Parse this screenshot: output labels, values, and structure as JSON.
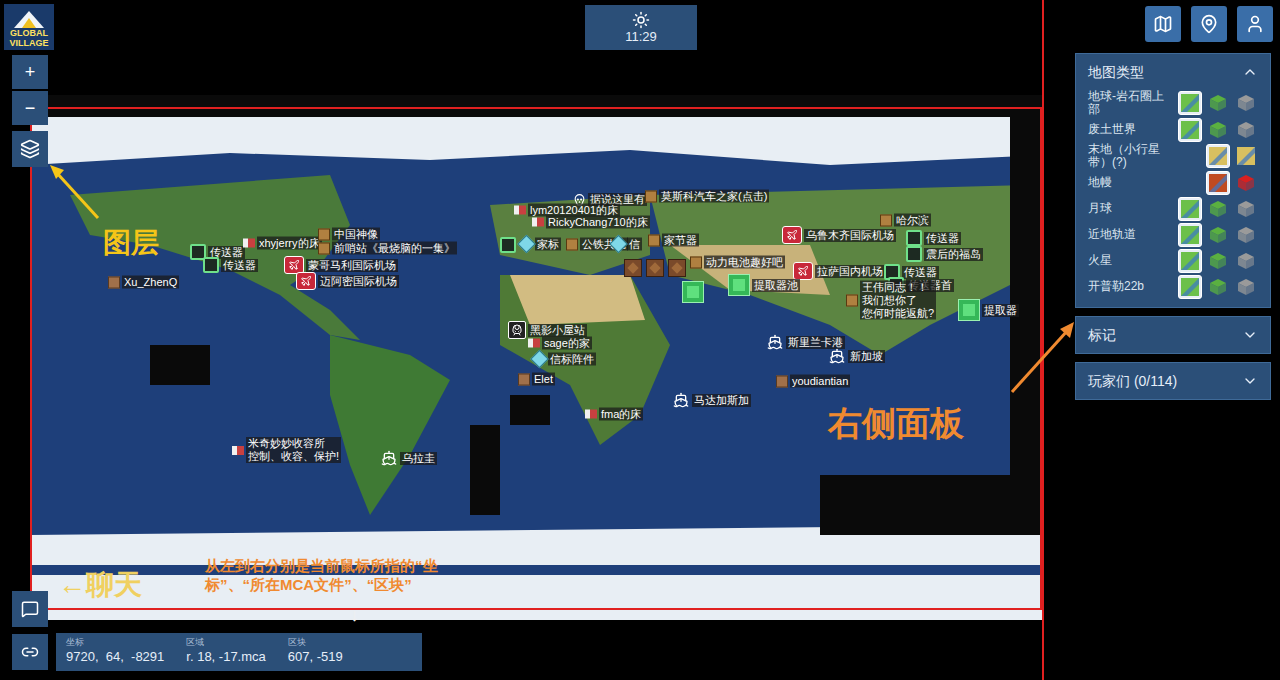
{
  "logo": {
    "lines": [
      "GLOBAL",
      "VILLAGE"
    ]
  },
  "clock": {
    "time": "11:29"
  },
  "zoom": {
    "in": "+",
    "out": "−"
  },
  "annotations": {
    "layers": "图层",
    "chat": "←聊天",
    "coords_hint": [
      "从左到右分别是当前鼠标所指的“坐",
      "标”、“所在MCA文件”、“区块”"
    ],
    "coords_arrow": "↓",
    "right_panel": "右侧面板"
  },
  "coords_bar": [
    {
      "label": "坐标",
      "value": "9720,  64,  -8291"
    },
    {
      "label": "区域",
      "value": "r. 18, -17.mca"
    },
    {
      "label": "区块",
      "value": "607, -519"
    }
  ],
  "panel": {
    "sections": [
      {
        "title": "地图类型",
        "expanded": true
      },
      {
        "title": "标记",
        "expanded": false
      },
      {
        "title": "玩家们 (0/114)",
        "expanded": false
      }
    ],
    "map_types": [
      {
        "label": "地球-岩石圈上部",
        "modes": [
          {
            "kind": "flat",
            "color": "#6cc04a",
            "selected": true
          },
          {
            "kind": "cube",
            "color": "#5ab040",
            "selected": false
          },
          {
            "kind": "cube",
            "color": "#9a9a9a",
            "selected": false
          }
        ]
      },
      {
        "label": "废土世界",
        "modes": [
          {
            "kind": "flat",
            "color": "#6cc04a",
            "selected": true
          },
          {
            "kind": "cube",
            "color": "#5ab040",
            "selected": false
          },
          {
            "kind": "cube",
            "color": "#9a9a9a",
            "selected": false
          }
        ]
      },
      {
        "label": "末地（小行星带）(?)",
        "modes": [
          {
            "kind": "flat",
            "color": "#d8c060",
            "selected": true
          },
          {
            "kind": "flat",
            "color": "#d8c060",
            "selected": false
          }
        ]
      },
      {
        "label": "地幔",
        "modes": [
          {
            "kind": "flat",
            "color": "#c04a20",
            "selected": true
          },
          {
            "kind": "cube",
            "color": "#d82020",
            "selected": false
          }
        ]
      },
      {
        "label": "月球",
        "modes": [
          {
            "kind": "flat",
            "color": "#6cc04a",
            "selected": true
          },
          {
            "kind": "cube",
            "color": "#5ab040",
            "selected": false
          },
          {
            "kind": "cube",
            "color": "#9a9a9a",
            "selected": false
          }
        ]
      },
      {
        "label": "近地轨道",
        "modes": [
          {
            "kind": "flat",
            "color": "#6cc04a",
            "selected": true
          },
          {
            "kind": "cube",
            "color": "#5ab040",
            "selected": false
          },
          {
            "kind": "cube",
            "color": "#9a9a9a",
            "selected": false
          }
        ]
      },
      {
        "label": "火星",
        "modes": [
          {
            "kind": "flat",
            "color": "#6cc04a",
            "selected": true
          },
          {
            "kind": "cube",
            "color": "#5ab040",
            "selected": false
          },
          {
            "kind": "cube",
            "color": "#9a9a9a",
            "selected": false
          }
        ]
      },
      {
        "label": "开普勒22b",
        "modes": [
          {
            "kind": "flat",
            "color": "#6cc04a",
            "selected": true
          },
          {
            "kind": "cube",
            "color": "#5ab040",
            "selected": false
          },
          {
            "kind": "cube",
            "color": "#9a9a9a",
            "selected": false
          }
        ]
      }
    ]
  },
  "pins": [
    {
      "kind": "player",
      "lines": [
        "Xu_ZhenQ"
      ]
    },
    {
      "kind": "teleporter",
      "lines": [
        "传送器"
      ]
    },
    {
      "kind": "teleporter",
      "lines": [
        "传送器"
      ]
    },
    {
      "kind": "bed",
      "lines": [
        "xhyjerry的床"
      ]
    },
    {
      "kind": "sign",
      "lines": [
        "中国神像"
      ]
    },
    {
      "kind": "sign",
      "lines": [
        "前哨站《最烧脑的一集》"
      ]
    },
    {
      "kind": "airport",
      "lines": [
        "蒙哥马利国际机场"
      ]
    },
    {
      "kind": "airport",
      "lines": [
        "迈阿密国际机场"
      ]
    },
    {
      "kind": "skull",
      "lines": [
        "据说这里有"
      ]
    },
    {
      "kind": "sign",
      "lines": [
        "莫斯科汽车之家(点击)"
      ]
    },
    {
      "kind": "bed",
      "lines": [
        "lym20120401的床"
      ]
    },
    {
      "kind": "bed",
      "lines": [
        "RickyChang710的床"
      ]
    },
    {
      "kind": "teleporter",
      "lines": []
    },
    {
      "kind": "beacon",
      "lines": [
        "家标"
      ]
    },
    {
      "kind": "sign",
      "lines": [
        "公铁共轨"
      ]
    },
    {
      "kind": "beacon",
      "lines": [
        "信"
      ]
    },
    {
      "kind": "sign",
      "lines": [
        "家节器"
      ]
    },
    {
      "kind": "crate",
      "lines": []
    },
    {
      "kind": "crate",
      "lines": []
    },
    {
      "kind": "crate",
      "lines": []
    },
    {
      "kind": "sign",
      "lines": [
        "动力电池趣好吧"
      ]
    },
    {
      "kind": "airport",
      "lines": [
        "乌鲁木齐国际机场"
      ]
    },
    {
      "kind": "sign",
      "lines": [
        "哈尔滨"
      ]
    },
    {
      "kind": "teleporter",
      "lines": [
        "传送器"
      ]
    },
    {
      "kind": "teleporter",
      "lines": [
        "震后的福岛"
      ]
    },
    {
      "kind": "airport",
      "lines": [
        "拉萨国内机场"
      ]
    },
    {
      "kind": "extractor",
      "lines": []
    },
    {
      "kind": "extractor",
      "lines": [
        "提取器池"
      ]
    },
    {
      "kind": "teleporter",
      "lines": [
        "传送器"
      ]
    },
    {
      "kind": "teleporter",
      "lines": [
        "传送器首"
      ]
    },
    {
      "kind": "sign",
      "lines": [
        "王伟同志！！",
        "我们想你了",
        "您何时能返航?"
      ]
    },
    {
      "kind": "extractor",
      "lines": [
        "提取器"
      ]
    },
    {
      "kind": "metro",
      "lines": [
        "黑影小屋站"
      ]
    },
    {
      "kind": "bed",
      "lines": [
        "sage的家"
      ]
    },
    {
      "kind": "beacon",
      "lines": [
        "信标阵件"
      ]
    },
    {
      "kind": "player",
      "lines": [
        "Elet"
      ]
    },
    {
      "kind": "port",
      "lines": [
        "斯里兰卡港"
      ]
    },
    {
      "kind": "port",
      "lines": [
        "新加坡"
      ]
    },
    {
      "kind": "player",
      "lines": [
        "youdiantian"
      ]
    },
    {
      "kind": "bed",
      "lines": [
        "fma的床"
      ]
    },
    {
      "kind": "port",
      "lines": [
        "马达加斯加"
      ]
    },
    {
      "kind": "bed",
      "lines": [
        "米奇妙妙收容所",
        "控制、收容、保护!"
      ]
    },
    {
      "kind": "port",
      "lines": [
        "乌拉圭"
      ]
    }
  ]
}
